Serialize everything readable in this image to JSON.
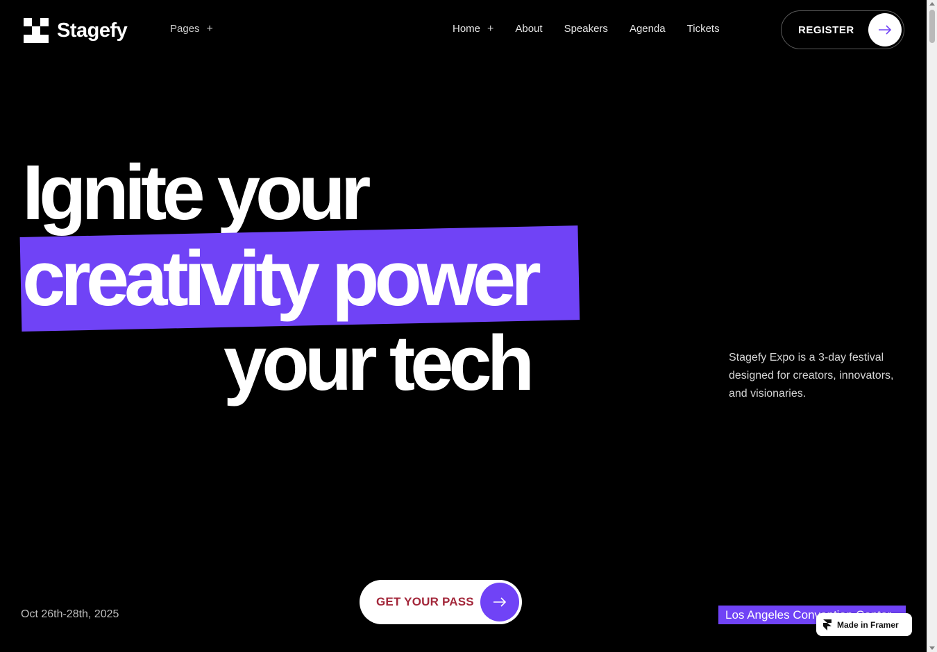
{
  "brand": {
    "name": "Stagefy"
  },
  "nav_left": {
    "label": "Pages",
    "plus": "+"
  },
  "nav_right": [
    {
      "label": "Home",
      "plus": "+"
    },
    {
      "label": "About"
    },
    {
      "label": "Speakers"
    },
    {
      "label": "Agenda"
    },
    {
      "label": "Tickets"
    }
  ],
  "register": {
    "label": "REGISTER",
    "icon": "arrow-right-icon"
  },
  "hero": {
    "line1": "Ignite your",
    "line2": "creativity power",
    "line3": "your tech",
    "description": "Stagefy Expo is a 3-day festival designed for creators, innovators, and visionaries."
  },
  "event": {
    "date": "Oct 26th-28th, 2025",
    "venue": "Los Angeles Convention Center"
  },
  "cta": {
    "label": "GET YOUR PASS",
    "icon": "arrow-right-icon"
  },
  "badge": {
    "label": "Made in Framer"
  },
  "colors": {
    "accent": "#7043f6",
    "background": "#000000",
    "cta_text": "#a3273a"
  }
}
